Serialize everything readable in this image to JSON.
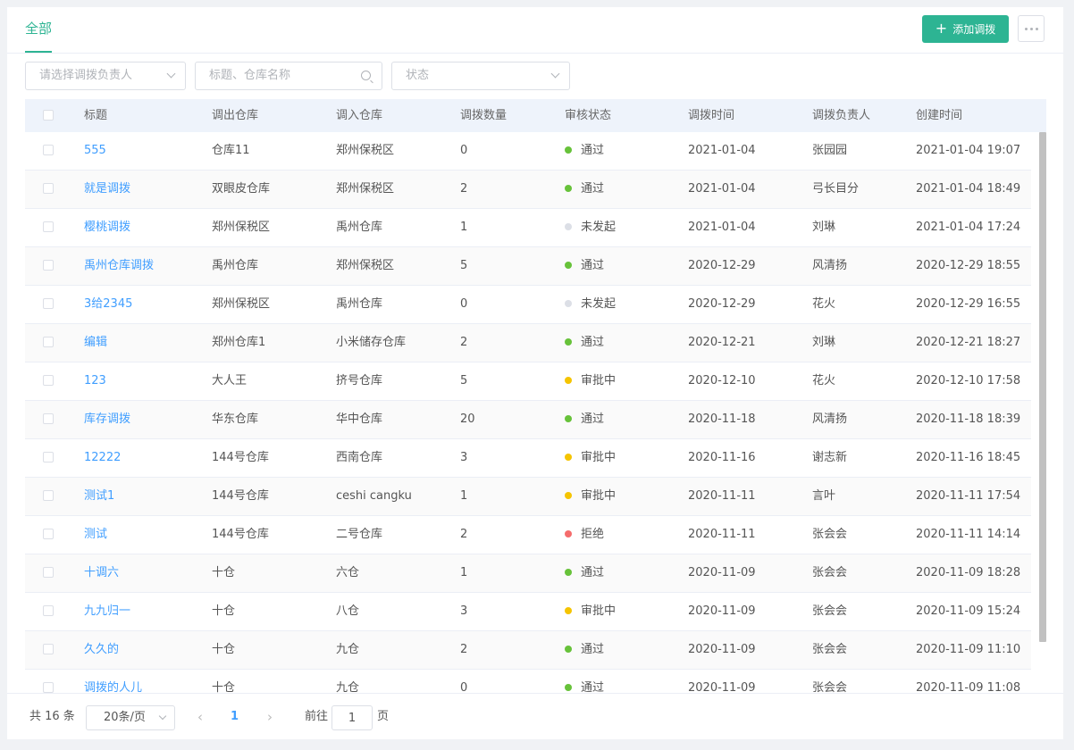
{
  "header": {
    "tab_all": "全部",
    "add_button": "添加调拨"
  },
  "filters": {
    "owner_placeholder": "请选择调拨负责人",
    "search_placeholder": "标题、仓库名称",
    "status_placeholder": "状态"
  },
  "table": {
    "columns": [
      "标题",
      "调出仓库",
      "调入仓库",
      "调拨数量",
      "审核状态",
      "调拨时间",
      "调拨负责人",
      "创建时间"
    ],
    "rows": [
      {
        "title": "555",
        "from": "仓库11",
        "to": "郑州保税区",
        "qty": "0",
        "status": "通过",
        "date": "2021-01-04",
        "owner": "张园园",
        "created": "2021-01-04 19:07"
      },
      {
        "title": "就是调拨",
        "from": "双眼皮仓库",
        "to": "郑州保税区",
        "qty": "2",
        "status": "通过",
        "date": "2021-01-04",
        "owner": "弓长目分",
        "created": "2021-01-04 18:49"
      },
      {
        "title": "樱桃调拨",
        "from": "郑州保税区",
        "to": "禹州仓库",
        "qty": "1",
        "status": "未发起",
        "date": "2021-01-04",
        "owner": "刘琳",
        "created": "2021-01-04 17:24"
      },
      {
        "title": "禹州仓库调拨",
        "from": "禹州仓库",
        "to": "郑州保税区",
        "qty": "5",
        "status": "通过",
        "date": "2020-12-29",
        "owner": "风清扬",
        "created": "2020-12-29 18:55"
      },
      {
        "title": "3给2345",
        "from": "郑州保税区",
        "to": "禹州仓库",
        "qty": "0",
        "status": "未发起",
        "date": "2020-12-29",
        "owner": "花火",
        "created": "2020-12-29 16:55"
      },
      {
        "title": "编辑",
        "from": "郑州仓库1",
        "to": "小米储存仓库",
        "qty": "2",
        "status": "通过",
        "date": "2020-12-21",
        "owner": "刘琳",
        "created": "2020-12-21 18:27"
      },
      {
        "title": "123",
        "from": "大人王",
        "to": "挤号仓库",
        "qty": "5",
        "status": "审批中",
        "date": "2020-12-10",
        "owner": "花火",
        "created": "2020-12-10 17:58"
      },
      {
        "title": "库存调拨",
        "from": "华东仓库",
        "to": "华中仓库",
        "qty": "20",
        "status": "通过",
        "date": "2020-11-18",
        "owner": "风清扬",
        "created": "2020-11-18 18:39"
      },
      {
        "title": "12222",
        "from": "144号仓库",
        "to": "西南仓库",
        "qty": "3",
        "status": "审批中",
        "date": "2020-11-16",
        "owner": "谢志新",
        "created": "2020-11-16 18:45"
      },
      {
        "title": "测试1",
        "from": "144号仓库",
        "to": "ceshi cangku",
        "qty": "1",
        "status": "审批中",
        "date": "2020-11-11",
        "owner": "言叶",
        "created": "2020-11-11 17:54"
      },
      {
        "title": "测试",
        "from": "144号仓库",
        "to": "二号仓库",
        "qty": "2",
        "status": "拒绝",
        "date": "2020-11-11",
        "owner": "张会会",
        "created": "2020-11-11 14:14"
      },
      {
        "title": "十调六",
        "from": "十仓",
        "to": "六仓",
        "qty": "1",
        "status": "通过",
        "date": "2020-11-09",
        "owner": "张会会",
        "created": "2020-11-09 18:28"
      },
      {
        "title": "九九归一",
        "from": "十仓",
        "to": "八仓",
        "qty": "3",
        "status": "审批中",
        "date": "2020-11-09",
        "owner": "张会会",
        "created": "2020-11-09 15:24"
      },
      {
        "title": "久久的",
        "from": "十仓",
        "to": "九仓",
        "qty": "2",
        "status": "通过",
        "date": "2020-11-09",
        "owner": "张会会",
        "created": "2020-11-09 11:10"
      },
      {
        "title": "调拨的人儿",
        "from": "十仓",
        "to": "九仓",
        "qty": "0",
        "status": "通过",
        "date": "2020-11-09",
        "owner": "张会会",
        "created": "2020-11-09 11:08"
      }
    ]
  },
  "status_colors": {
    "通过": "#67c23a",
    "未发起": "#dcdfe6",
    "审批中": "#f5c400",
    "拒绝": "#f56c6c"
  },
  "pagination": {
    "total": "共 16 条",
    "page_size": "20条/页",
    "current_page": "1",
    "goto_prefix": "前往",
    "goto_value": "1",
    "goto_suffix": "页"
  },
  "colors": {
    "accent": "#2db493",
    "link": "#409eff"
  }
}
